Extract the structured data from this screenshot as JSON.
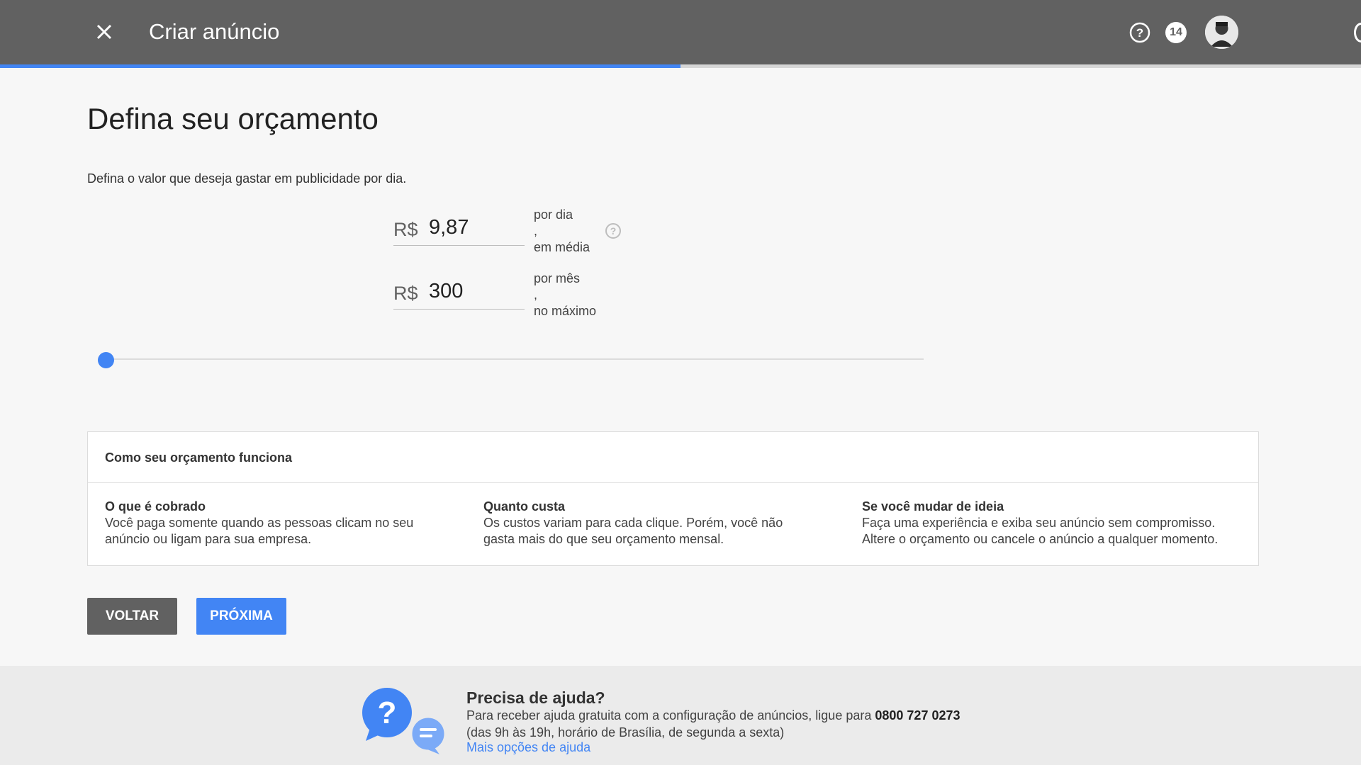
{
  "header": {
    "title": "Criar anúncio",
    "notifications_count": "14",
    "progress_percent": 50
  },
  "main": {
    "title": "Defina seu orçamento",
    "description": "Defina o valor que deseja gastar em publicidade por dia.",
    "daily": {
      "currency": "R$",
      "value": "9,87",
      "unit_line1": "por dia",
      "unit_line2": ",",
      "unit_line3": "em média"
    },
    "monthly": {
      "currency": "R$",
      "value": "300",
      "unit_line1": "por mês",
      "unit_line2": ",",
      "unit_line3": "no máximo"
    },
    "slider_level": 0
  },
  "infobox": {
    "title": "Como seu orçamento funciona",
    "columns": [
      {
        "title": "O que é cobrado",
        "line1": "Você paga somente quando as pessoas clicam no seu",
        "line2": "anúncio ou ligam para sua empresa."
      },
      {
        "title": "Quanto custa",
        "line1": "Os custos variam para cada clique. Porém, você não",
        "line2": "gasta mais do que seu orçamento mensal."
      },
      {
        "title": "Se você mudar de ideia",
        "line1": "Faça uma experiência e exiba seu anúncio sem compromisso.",
        "line2": "Altere o orçamento ou cancele o anúncio a qualquer momento."
      }
    ]
  },
  "buttons": {
    "back": "VOLTAR",
    "next": "PRÓXIMA"
  },
  "footer": {
    "title": "Precisa de ajuda?",
    "line1_text": "Para receber ajuda gratuita com a configuração de anúncios, ligue para ",
    "phone": "0800 727 0273",
    "line2": "(das 9h às 19h, horário de Brasília, de segunda a sexta)",
    "link": "Mais opções de ajuda"
  },
  "colors": {
    "header_bg": "#616161",
    "accent": "#4285f4",
    "back_button": "#616161",
    "footer_bg": "#ebebeb"
  }
}
